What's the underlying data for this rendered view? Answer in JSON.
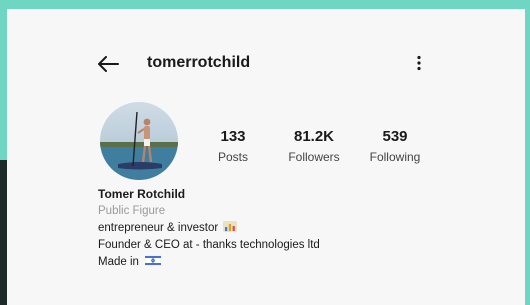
{
  "profile": {
    "username": "tomerrotchild",
    "display_name": "Tomer Rotchild",
    "category": "Public Figure",
    "bio_lines": [
      "entrepreneur & investor",
      "Founder & CEO at - thanks technologies ltd",
      "Made in"
    ]
  },
  "stats": [
    {
      "value": "133",
      "label": "Posts"
    },
    {
      "value": "81.2K",
      "label": "Followers"
    },
    {
      "value": "539",
      "label": "Following"
    }
  ],
  "colors": {
    "background_accent": "#6fd6c4",
    "card": "#f7f7f7",
    "text": "#1a1a1a",
    "muted": "#9a9a9a"
  },
  "icons": {
    "back": "arrow-left-icon",
    "more": "more-vertical-icon",
    "bio_emoji": "bar-chart-icon",
    "bio_flag": "israel-flag-icon"
  }
}
